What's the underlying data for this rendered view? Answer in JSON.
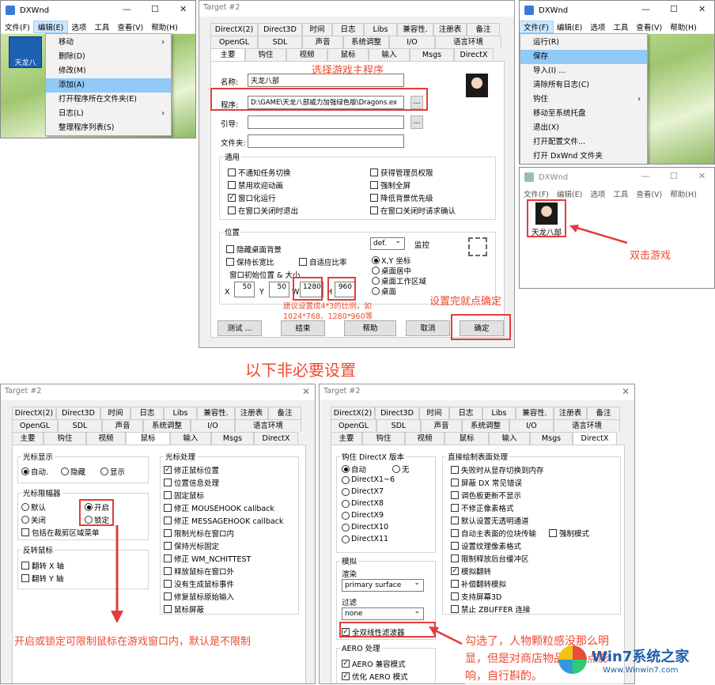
{
  "win1": {
    "title": "DXWnd",
    "menu": [
      "文件(F)",
      "编辑(E)",
      "选项",
      "工具",
      "查看(V)",
      "帮助(H)"
    ],
    "icon_label": "天龙八",
    "items": [
      {
        "label": "移动",
        "sub": true
      },
      {
        "label": "删除(D)"
      },
      {
        "label": "修改(M)"
      },
      {
        "label": "添加(A)",
        "hl": true
      },
      {
        "label": "打开程序所在文件夹(E)"
      },
      {
        "label": "日志(L)",
        "sub": true
      },
      {
        "label": "整理程序列表(S)"
      }
    ]
  },
  "win3": {
    "title": "DXWnd",
    "menu": [
      "文件(F)",
      "编辑(E)",
      "选项",
      "工具",
      "查看(V)",
      "帮助(H)"
    ],
    "items": [
      {
        "label": "运行(R)"
      },
      {
        "label": "保存",
        "hl": true
      },
      {
        "label": "导入(I) ..."
      },
      {
        "label": "清除所有日志(C)"
      },
      {
        "label": "钩住",
        "sub": true
      },
      {
        "label": "移动至系统托盘"
      },
      {
        "label": "退出(X)"
      },
      {
        "label": "打开配置文件..."
      },
      {
        "label": "打开 DxWnd 文件夹"
      }
    ]
  },
  "win4": {
    "title": "DXWnd",
    "menu": [
      "文件(F)",
      "编辑(E)",
      "选项",
      "工具",
      "查看(V)",
      "帮助(H)"
    ],
    "icon_label": "天龙八部"
  },
  "target": {
    "title": "Target #2",
    "tabs_row1": [
      "DirectX(2)",
      "Direct3D",
      "时间",
      "日志",
      "Libs",
      "兼容性.",
      "注册表",
      "备注"
    ],
    "tabs_row2": [
      "OpenGL",
      "SDL",
      "声音",
      "系统调整",
      "I/O",
      "语言环境"
    ],
    "tabs_row3": [
      "主要",
      "钩住",
      "视频",
      "鼠标",
      "输入",
      "Msgs",
      "DirectX"
    ]
  },
  "main": {
    "name_label": "名称:",
    "name_value": "天龙八部",
    "prog_label": "程序:",
    "prog_value": "D:\\GAME\\天龙八部威力加强绿色版\\Dragons.ex",
    "browse": "...",
    "hook_label": "引导:",
    "folder_label": "文件夹:",
    "general_title": "通用",
    "general": [
      {
        "label": "不通知任务切换",
        "checked": false
      },
      {
        "label": "获得管理员权限",
        "checked": false
      },
      {
        "label": "禁用欢迎动画",
        "checked": false
      },
      {
        "label": "强制全屏",
        "checked": false
      },
      {
        "label": "窗口化运行",
        "checked": true
      },
      {
        "label": "降低背景优先级",
        "checked": false
      },
      {
        "label": "在窗口关闭时退出",
        "checked": false
      },
      {
        "label": "在窗口关闭时请求确认",
        "checked": false
      }
    ],
    "pos_title": "位置",
    "hide_bg": "隐藏桌面背景",
    "keep_ratio": "保持长宽比",
    "auto_ratio": "自适应比率",
    "init_pos": "窗口初始位置 & 大小",
    "x_label": "X",
    "x": "50",
    "y_label": "Y",
    "y": "50",
    "w_label": "W",
    "w": "1280",
    "h_label": "H",
    "h": "960",
    "def": "def.",
    "monitor": "监控",
    "coords": [
      {
        "label": "X,Y 坐标",
        "on": true
      },
      {
        "label": "桌面居中",
        "on": false
      },
      {
        "label": "桌面工作区域",
        "on": false
      },
      {
        "label": "桌面",
        "on": false
      }
    ],
    "btn_test": "测试 ...",
    "btn_end": "结束",
    "btn_help": "帮助",
    "btn_cancel": "取消",
    "btn_ok": "确定"
  },
  "mouse": {
    "cursor_title": "光标显示",
    "cursor_opts": [
      {
        "label": "自动.",
        "on": true
      },
      {
        "label": "隐藏",
        "on": false
      },
      {
        "label": "显示",
        "on": false
      }
    ],
    "clip_title": "光标限幅器",
    "clip_opts": [
      {
        "label": "默认",
        "on": false
      },
      {
        "label": "开启",
        "on": true
      },
      {
        "label": "关闭",
        "on": false
      },
      {
        "label": "锁定",
        "on": false
      }
    ],
    "clip_menu": "包括在裁剪区域菜单",
    "invert_title": "反转鼠标",
    "invert": [
      "翻转 X 轴",
      "翻转 Y 轴"
    ],
    "proc_title": "光标处理",
    "proc": [
      {
        "label": "修正鼠标位置",
        "checked": true
      },
      {
        "label": "位置信息处理",
        "checked": false
      },
      {
        "label": "固定鼠标",
        "checked": false
      },
      {
        "label": "修正 MOUSEHOOK callback",
        "checked": false
      },
      {
        "label": "修正 MESSAGEHOOK callback",
        "checked": false
      },
      {
        "label": "限制光标在窗口内",
        "checked": false
      },
      {
        "label": "保持光标固定",
        "checked": false
      },
      {
        "label": "修正 WM_NCHITTEST",
        "checked": false
      },
      {
        "label": "释放鼠标在窗口外",
        "checked": false
      },
      {
        "label": "没有生成鼠标事件",
        "checked": false
      },
      {
        "label": "修复鼠标原始输入",
        "checked": false
      },
      {
        "label": "鼠标屏蔽",
        "checked": false
      }
    ]
  },
  "dx": {
    "ver_title": "钩住 DirectX 版本",
    "ver_opts": [
      {
        "label": "自动",
        "on": true
      },
      {
        "label": "无",
        "on": false
      },
      {
        "label": "DirectX1~6",
        "on": false
      },
      {
        "label": "DirectX7",
        "on": false
      },
      {
        "label": "DirectX8",
        "on": false
      },
      {
        "label": "DirectX9",
        "on": false
      },
      {
        "label": "DirectX10",
        "on": false
      },
      {
        "label": "DirectX11",
        "on": false
      }
    ],
    "emu_title": "模拟",
    "render_label": "渲染",
    "render_value": "primary surface",
    "filter_label": "过滤",
    "filter_value": "none",
    "bilinear": "全双线性滤波器",
    "aero_title": "AERO 处理",
    "aero": [
      "AERO 兼容模式",
      "优化 AERO 模式"
    ],
    "surf_title": "直接绘制表面处理",
    "surf": [
      {
        "label": "失败时从显存切换到内存",
        "checked": false
      },
      {
        "label": "屏蔽 DX 常见错误",
        "checked": false
      },
      {
        "label": "调色板更新不显示",
        "checked": false
      },
      {
        "label": "不修正像素格式",
        "checked": false
      },
      {
        "label": "默认设置无透明通道",
        "checked": false
      },
      {
        "label": "自动主表面的位块传输",
        "checked": false
      },
      {
        "label": "设置纹理像素格式",
        "checked": false
      },
      {
        "label": "限制释放后台缓冲区",
        "checked": false
      },
      {
        "label": "模拟翻转",
        "checked": true
      },
      {
        "label": "补偿翻转模拟",
        "checked": false
      },
      {
        "label": "支持屏幕3D",
        "checked": false
      },
      {
        "label": "禁止 ZBUFFER 连接",
        "checked": false
      }
    ],
    "force_mode": "强制模式"
  },
  "annotations": {
    "select_prog": "选择游戏主程序",
    "suggest": "建议设置成4*3的比例，如 1024*768、1280*960等",
    "confirm": "设置完就点确定",
    "dblclick": "双击游戏",
    "optional": "以下非必要设置",
    "mouse_note": "开启或锁定可限制鼠标在游戏窗口内，默认是不限制",
    "filter_note": "勾选了，人物颗粒感没那么明显，但是对商店物品有一点影响，自行斟酌。",
    "watermark": "Win7系统之家",
    "watermark_url": "Www.Winwin7.com"
  }
}
